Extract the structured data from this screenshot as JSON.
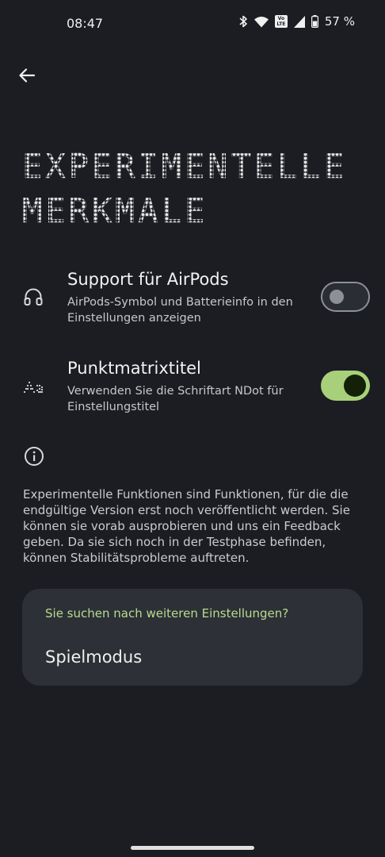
{
  "status_bar": {
    "time": "08:47",
    "volte": "Vo\nLTE",
    "battery": "57 %",
    "icons": [
      "bluetooth-icon",
      "wifi-icon",
      "volte-icon",
      "signal-icon",
      "battery-icon"
    ]
  },
  "header": {
    "back_icon": "arrow-left-icon",
    "title_line1": "EXPERIMENTELLE",
    "title_line2": "MERKMALE"
  },
  "settings": [
    {
      "icon": "headphones-icon",
      "title": "Support für AirPods",
      "description": "AirPods-Symbol und Batterieinfo in den Einstellungen anzeigen",
      "enabled": false
    },
    {
      "icon": "dot-matrix-font-icon",
      "title": "Punktmatrixtitel",
      "description": "Verwenden Sie die Schriftart NDot für Einstellungstitel",
      "enabled": true
    }
  ],
  "info": {
    "icon": "info-icon",
    "text": "Experimentelle Funktionen sind Funktionen, für die die endgültige Version erst noch veröffentlicht werden. Sie können sie vorab ausprobieren und uns ein Feedback geben. Da sie sich noch in der Testphase befinden, können Stabilitätsprobleme auftreten."
  },
  "more_settings": {
    "header": "Sie suchen nach weiteren Einstellungen?",
    "link": "Spielmodus"
  },
  "colors": {
    "background": "#1b1d22",
    "accent": "#a8d07a",
    "card": "#2d3036",
    "card_header": "#b9dc8f"
  }
}
